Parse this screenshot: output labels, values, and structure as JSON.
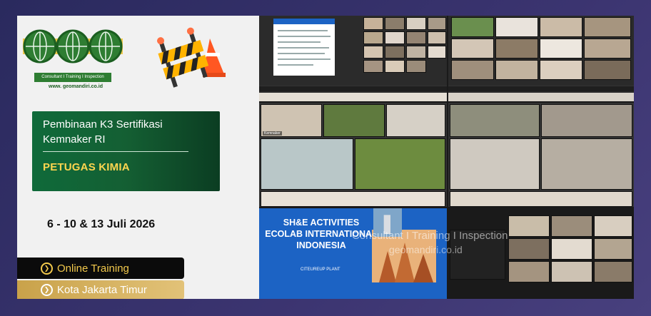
{
  "logo": {
    "tagline": "Consultant I Training I Inspection",
    "url": "www. geomandiri.co.id",
    "brand_color": "#2e7d32"
  },
  "program": {
    "title": "Pembinaan K3 Sertifikasi Kemnaker RI",
    "subtitle": "PETUGAS KIMIA"
  },
  "date": "6 - 10 & 13 Juli 2026",
  "mode_label": "Online Training",
  "location_label": "Kota Jakarta Timur",
  "icons": [
    "chevron-right-circle-icon",
    "road-barrier-icon",
    "traffic-cone-icon"
  ],
  "collage": {
    "slide_title": "SH&E ACTIVITIES ECOLAB INTERNATIONAL INDONESIA",
    "slide_subtitle": "CITEUREUP PLANT",
    "watermark_text": "Consultant I Training I Inspection",
    "watermark_url": "geomandiri.co.id"
  },
  "colors": {
    "green_box": "#0f6a3a",
    "accent_yellow": "#f2c94c",
    "gold": "#c9a24a",
    "slide_blue": "#1c63c4"
  }
}
